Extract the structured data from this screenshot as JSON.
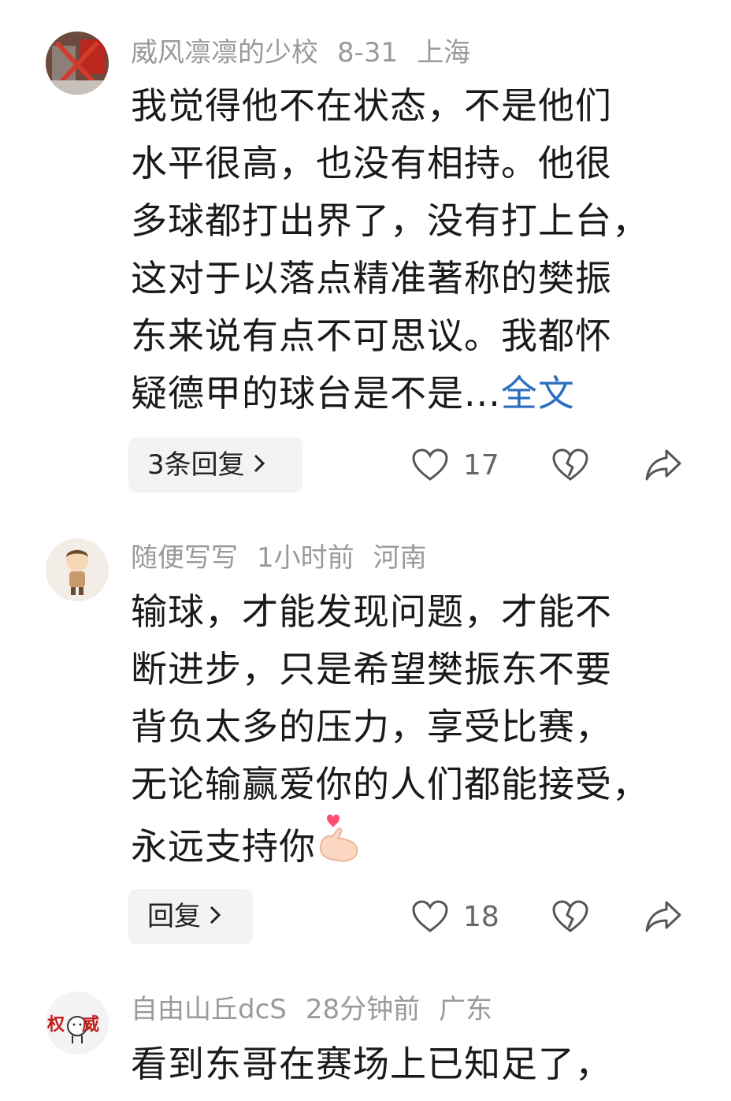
{
  "comments": [
    {
      "username": "威风凛凛的少校",
      "time": "8-31",
      "location": "上海",
      "lines": [
        "我觉得他不在状态，不是他们",
        "水平很高，也没有相持。他很",
        "多球都打出界了，没有打上台，",
        "这对于以落点精准著称的樊振",
        "东来说有点不可思议。我都怀",
        "疑德甲的球台是不是..."
      ],
      "full_text_link": "全文",
      "reply_label": "3条回复",
      "likes": "17"
    },
    {
      "username": "随便写写",
      "time": "1小时前",
      "location": "河南",
      "lines": [
        "输球，才能发现问题，才能不",
        "断进步，只是希望樊振东不要",
        "背负太多的压力，享受比赛，",
        "无论输赢爱你的人们都能接受，",
        "永远支持你"
      ],
      "reply_label": "回复",
      "likes": "18"
    },
    {
      "username": "自由山丘dcS",
      "time": "28分钟前",
      "location": "广东",
      "lines": [
        "看到东哥在赛场上已知足了，"
      ],
      "avatar_text": "权威"
    }
  ],
  "icons": {
    "like": "heart-outline-icon",
    "dislike": "broken-heart-icon",
    "share": "share-arrow-icon",
    "emoji": "finger-heart-emoji-icon"
  },
  "colors": {
    "meta": "#9a9a9a",
    "link": "#2b6fc2",
    "reply_bg": "#f3f3f3"
  }
}
